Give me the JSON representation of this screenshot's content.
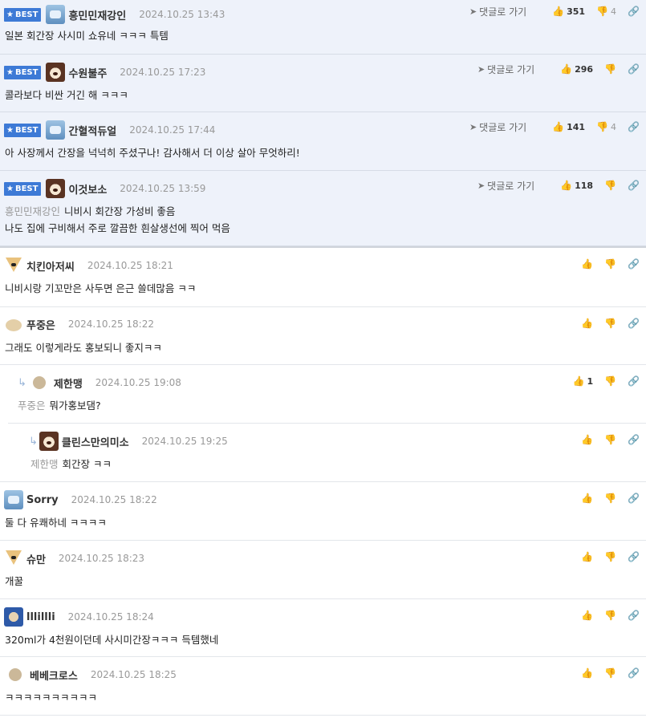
{
  "labels": {
    "best": "BEST",
    "goto": "댓글로 가기"
  },
  "icons": {
    "star": "★",
    "goto_arrow": "➤",
    "thumb_up": "👍",
    "thumb_down": "👎",
    "link": "🔗",
    "reply": "↳"
  },
  "colors": {
    "best_badge": "#3d7ad6",
    "best_bg": "#eef2fa",
    "mention": "#999999"
  },
  "best_comments": [
    {
      "nick": "흥민민재강인",
      "date": "2024.10.25 13:43",
      "text": "일본 회간장 사시미 쇼유네 ㅋㅋㅋ 특템",
      "up": "351",
      "down": "4",
      "avatar": "robot"
    },
    {
      "nick": "수원불주",
      "date": "2024.10.25 17:23",
      "text": "콜라보다 비싼 거긴 해 ㅋㅋㅋ",
      "up": "296",
      "down": "",
      "avatar": "dog"
    },
    {
      "nick": "간혈적듀얼",
      "date": "2024.10.25 17:44",
      "text": "아 사장께서 간장을 넉넉히 주셨구나! 감사해서 더 이상 살아 무엇하리!",
      "up": "141",
      "down": "4",
      "avatar": "robot"
    },
    {
      "nick": "이것보소",
      "date": "2024.10.25 13:59",
      "mention": "흥민민재강인",
      "text": "니비시 회간장 가성비 좋음",
      "text2": "나도 집에 구비해서 주로 깔끔한 흰살생선에 찍어 먹음",
      "up": "118",
      "down": "",
      "avatar": "dog"
    }
  ],
  "comments": [
    {
      "nick": "치킨아저씨",
      "date": "2024.10.25 18:21",
      "text": "니비시랑 기꼬만은 사두면 은근 쓸데많음 ㅋㅋ",
      "up": "",
      "avatar": "fox"
    },
    {
      "nick": "푸중은",
      "date": "2024.10.25 18:22",
      "text": "그래도 이렇게라도 홍보되니 좋지ㅋㅋ",
      "up": "",
      "avatar": "puppy"
    },
    {
      "nick": "제한맹",
      "date": "2024.10.25 19:08",
      "mention": "푸중은",
      "text": "뭐가홍보댐?",
      "up": "1",
      "avatar": "circle",
      "depth": 1
    },
    {
      "nick": "클린스만의미소",
      "date": "2024.10.25 19:25",
      "mention": "제한맹",
      "text": "회간장 ㅋㅋ",
      "up": "",
      "avatar": "dog",
      "depth": 2
    },
    {
      "nick": "Sorry",
      "date": "2024.10.25 18:22",
      "text": "둘 다 유쾌하네 ㅋㅋㅋㅋ",
      "up": "",
      "avatar": "robot"
    },
    {
      "nick": "슈만",
      "date": "2024.10.25 18:23",
      "text": "개꿀",
      "up": "",
      "avatar": "fox"
    },
    {
      "nick": "lllillli",
      "date": "2024.10.25 18:24",
      "text": "320ml가 4천원이던데 사시미간장ㅋㅋㅋ 득템했네",
      "up": "",
      "avatar": "bear"
    },
    {
      "nick": "베베크로스",
      "date": "2024.10.25 18:25",
      "text": "ㅋㅋㅋㅋㅋㅋㅋㅋㅋㅋ",
      "up": "",
      "avatar": "circle"
    }
  ]
}
